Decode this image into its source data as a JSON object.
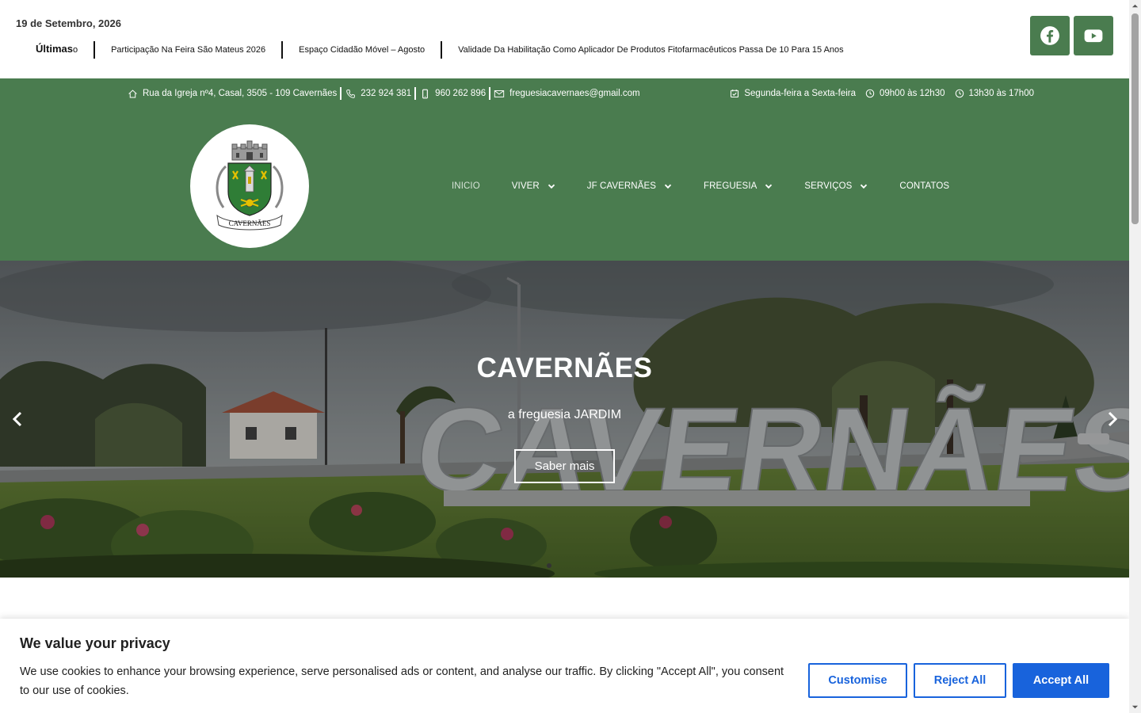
{
  "topbar": {
    "date": "19 de Setembro, 2026",
    "ticker_label": "Últimas",
    "ticker_items": [
      "o",
      "Participação Na Feira São Mateus 2026",
      "Espaço Cidadão Móvel – Agosto",
      "Validade Da Habilitação Como Aplicador De Produtos Fitofarmacêuticos Passa De 10 Para 15 Anos"
    ],
    "social": [
      "facebook-icon",
      "youtube-icon"
    ]
  },
  "infobar": {
    "address": "Rua da Igreja nº4, Casal, 3505 - 109 Cavernães",
    "phone": "232 924 381",
    "mobile": "960 262 896",
    "email": "freguesiacavernaes@gmail.com",
    "days": "Segunda-feira a Sexta-feira",
    "hours_morning": "09h00 às 12h30",
    "hours_afternoon": "13h30 às 17h00"
  },
  "logo": {
    "text": "CAVERNÃES"
  },
  "nav": {
    "items": [
      {
        "label": "INICIO",
        "dropdown": false
      },
      {
        "label": "VIVER",
        "dropdown": true
      },
      {
        "label": "JF CAVERNÃES",
        "dropdown": true
      },
      {
        "label": "FREGUESIA",
        "dropdown": true
      },
      {
        "label": "SERVIÇOS",
        "dropdown": true
      },
      {
        "label": "CONTATOS",
        "dropdown": false
      }
    ]
  },
  "hero": {
    "title": "CAVERNÃES",
    "subtitle": "a freguesia JARDIM",
    "cta": "Saber mais",
    "sign_text": "CAVERNÃES"
  },
  "cookie": {
    "title": "We value your privacy",
    "text": "We use cookies to enhance your browsing experience, serve personalised ads or content, and analyse our traffic. By clicking \"Accept All\", you consent to our use of cookies.",
    "customise": "Customise",
    "reject": "Reject All",
    "accept": "Accept All"
  },
  "colors": {
    "brand_green": "#4a7c4f",
    "cookie_blue": "#1863dc"
  }
}
